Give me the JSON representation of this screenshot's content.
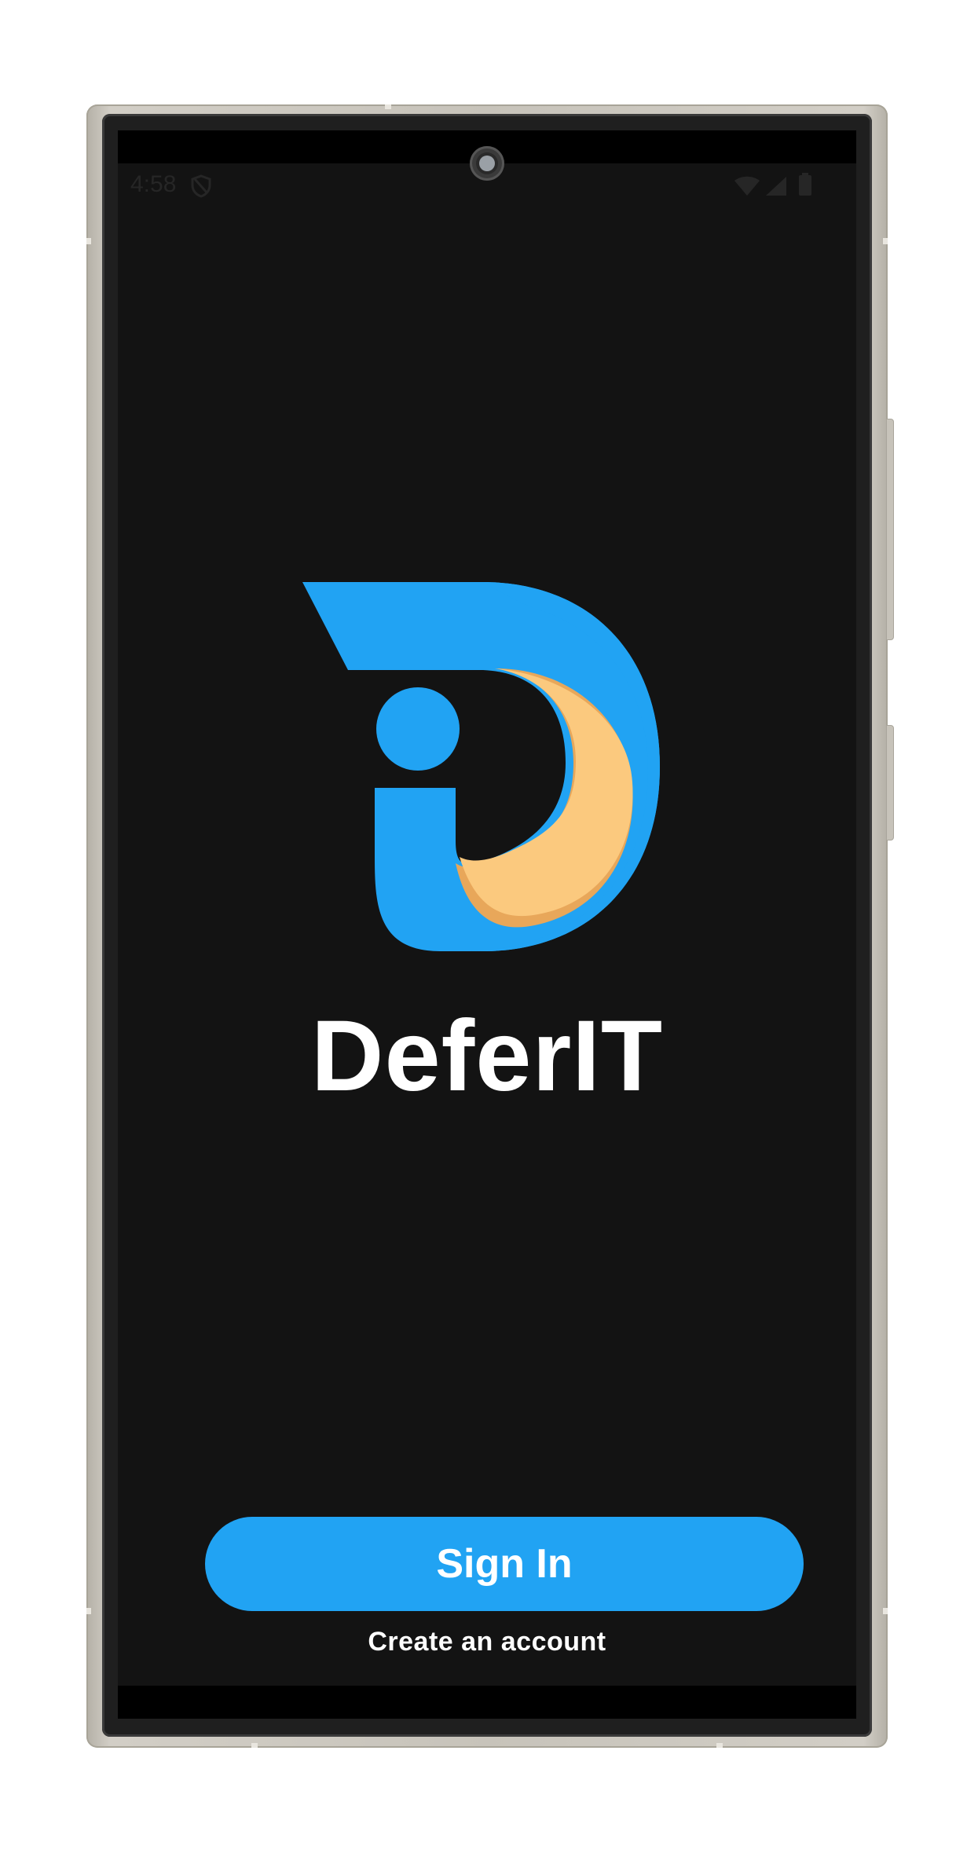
{
  "status_bar": {
    "time": "4:58",
    "icons": [
      "shield-icon",
      "wifi-icon",
      "cell-signal-icon",
      "battery-icon"
    ]
  },
  "app": {
    "name": "DeferIT",
    "logo": "deferit-logo",
    "colors": {
      "background": "#131313",
      "accent": "#21a3f3",
      "logo_blue": "#21a3f3",
      "logo_orange": "#fbc97e",
      "logo_orange_shade": "#e8a75a"
    }
  },
  "actions": {
    "sign_in_label": "Sign In",
    "create_account_label": "Create an account"
  }
}
